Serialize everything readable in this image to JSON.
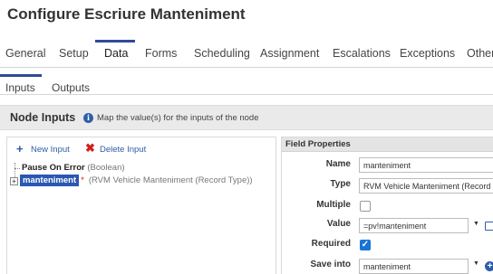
{
  "page": {
    "title": "Configure Escriure Manteniment"
  },
  "main_tabs": {
    "active": "Data",
    "items": [
      {
        "label": "General"
      },
      {
        "label": "Setup"
      },
      {
        "label": "Data"
      },
      {
        "label": "Forms"
      },
      {
        "label": "Scheduling"
      },
      {
        "label": "Assignment"
      },
      {
        "label": "Escalations"
      },
      {
        "label": "Exceptions"
      },
      {
        "label": "Other"
      }
    ]
  },
  "sub_tabs": {
    "active": "Inputs",
    "items": [
      {
        "label": "Inputs"
      },
      {
        "label": "Outputs"
      }
    ]
  },
  "node_inputs": {
    "title": "Node Inputs",
    "hint": "Map the value(s) for the inputs of the node",
    "new_input_label": "New Input",
    "delete_input_label": "Delete Input",
    "tree": [
      {
        "name": "Pause On Error",
        "type": "(Boolean)"
      },
      {
        "name": "manteniment",
        "required_marker": "*",
        "type": "(RVM Vehicle Manteniment (Record Type))",
        "expander": "+"
      }
    ]
  },
  "field_properties": {
    "title": "Field Properties",
    "name_label": "Name",
    "name_value": "manteniment",
    "type_label": "Type",
    "type_value": "RVM Vehicle Manteniment (Record Type)",
    "multiple_label": "Multiple",
    "multiple_checked": false,
    "value_label": "Value",
    "value_value": "=pv!manteniment",
    "required_label": "Required",
    "required_checked": true,
    "save_into_label": "Save into",
    "save_into_value": "manteniment"
  },
  "icons": {
    "info": "info-icon",
    "add": "plus-icon",
    "delete": "x-icon",
    "edit": "edit-icon",
    "add_circle": "add-circle-icon",
    "dropdown": "caret-down-icon"
  },
  "colors": {
    "accent": "#2e4b9a",
    "link": "#2e5da8",
    "danger": "#d0201b",
    "selection": "#2a57b2",
    "checkbox": "#1a73d6"
  }
}
